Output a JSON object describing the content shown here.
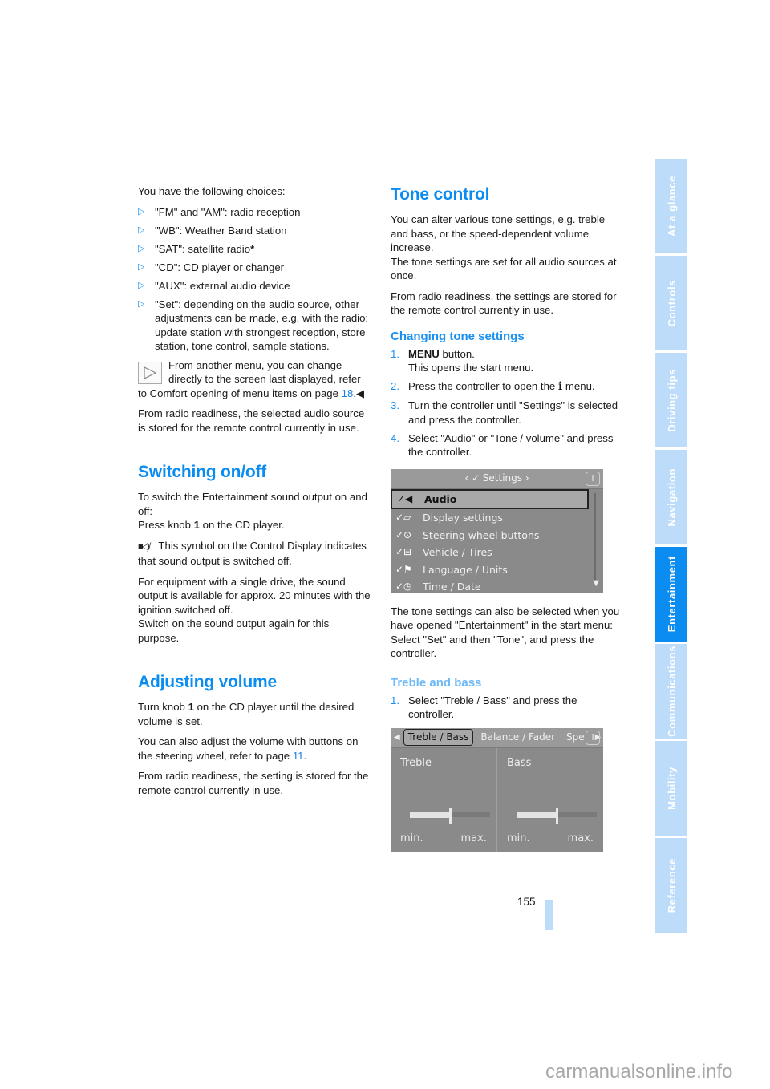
{
  "left": {
    "intro": "You have the following choices:",
    "choices": [
      "\"FM\" and \"AM\": radio reception",
      "\"WB\": Weather Band station",
      "\"SAT\": satellite radio",
      "\"CD\": CD player or changer",
      "\"AUX\": external audio device",
      "\"Set\": depending on the audio source, other adjustments can be made, e.g. with the radio: update station with strongest reception, store station, tone control, sample stations."
    ],
    "asterisk": "*",
    "note_text": "From another menu, you can change directly to the screen last displayed, refer to Comfort opening of menu items on page ",
    "note_page": "18",
    "note_end": ".◀",
    "radio_readiness": "From radio readiness, the selected audio source is stored for the remote control currently in use.",
    "switching": {
      "title": "Switching on/off",
      "p1": "To switch the Entertainment sound output on and off:",
      "p1b_pre": "Press knob ",
      "p1b_bold": "1",
      "p1b_post": " on the CD player.",
      "p2": " This symbol on the Control Display indicates that sound output is switched off.",
      "p3": "For equipment with a single drive, the sound output is available for approx. 20 minutes with the ignition switched off.",
      "p3b": "Switch on the sound output again for this purpose."
    },
    "volume": {
      "title": "Adjusting volume",
      "p1_pre": "Turn knob ",
      "p1_bold": "1",
      "p1_post": " on the CD player until the desired volume is set.",
      "p2_pre": "You can also adjust the volume with buttons on the steering wheel, refer to page ",
      "p2_link": "11",
      "p2_post": ".",
      "p3": "From radio readiness, the setting is stored for the remote control currently in use."
    }
  },
  "right": {
    "tone": {
      "title": "Tone control",
      "p1": "You can alter various tone settings, e.g. treble and bass, or the speed-dependent volume increase.",
      "p1b": "The tone settings are set for all audio sources at once.",
      "p2": "From radio readiness, the settings are stored for the remote control currently in use."
    },
    "changing": {
      "title": "Changing tone settings",
      "steps": [
        {
          "n": "1.",
          "bold": "MENU",
          "text": " button.",
          "sub": "This opens the start menu."
        },
        {
          "n": "2.",
          "pre": "Press the controller to open the ",
          "icon": "i",
          "post": " menu."
        },
        {
          "n": "3.",
          "text": "Turn the controller until \"Settings\" is selected and press the controller."
        },
        {
          "n": "4.",
          "text": "Select \"Audio\" or \"Tone / volume\" and press the controller."
        }
      ]
    },
    "settings_screen": {
      "title": "‹ ✓ Settings ›",
      "info": "i",
      "items": [
        "Audio",
        "Display settings",
        "Steering wheel buttons",
        "Vehicle / Tires",
        "Language / Units",
        "Time / Date"
      ],
      "selected_index": 0
    },
    "after_screen": {
      "p1": "The tone settings can also be selected when you have opened \"Entertainment\" in the start menu:",
      "p1b": "Select \"Set\" and then \"Tone\", and press the controller."
    },
    "treble": {
      "title": "Treble and bass",
      "step_n": "1.",
      "step": "Select \"Treble / Bass\" and press the controller."
    },
    "tone_screen": {
      "tabs": [
        "Treble / Bass",
        "Balance / Fader",
        "Spe"
      ],
      "selected_tab": 0,
      "info": "i",
      "panes": [
        {
          "label": "Treble",
          "min": "min.",
          "max": "max.",
          "level": 0.5
        },
        {
          "label": "Bass",
          "min": "min.",
          "max": "max.",
          "level": 0.5
        }
      ]
    }
  },
  "side_tabs": [
    {
      "label": "At a glance",
      "active": false
    },
    {
      "label": "Controls",
      "active": false
    },
    {
      "label": "Driving tips",
      "active": false
    },
    {
      "label": "Navigation",
      "active": false
    },
    {
      "label": "Entertainment",
      "active": true
    },
    {
      "label": "Communications",
      "active": false
    },
    {
      "label": "Mobility",
      "active": false
    },
    {
      "label": "Reference",
      "active": false
    }
  ],
  "page_number": "155",
  "watermark": "carmanualsonline.info",
  "colors": {
    "accent": "#0a8cf0",
    "tab_inactive": "#bcdcfa",
    "screen_bg": "#8a8a8a"
  }
}
